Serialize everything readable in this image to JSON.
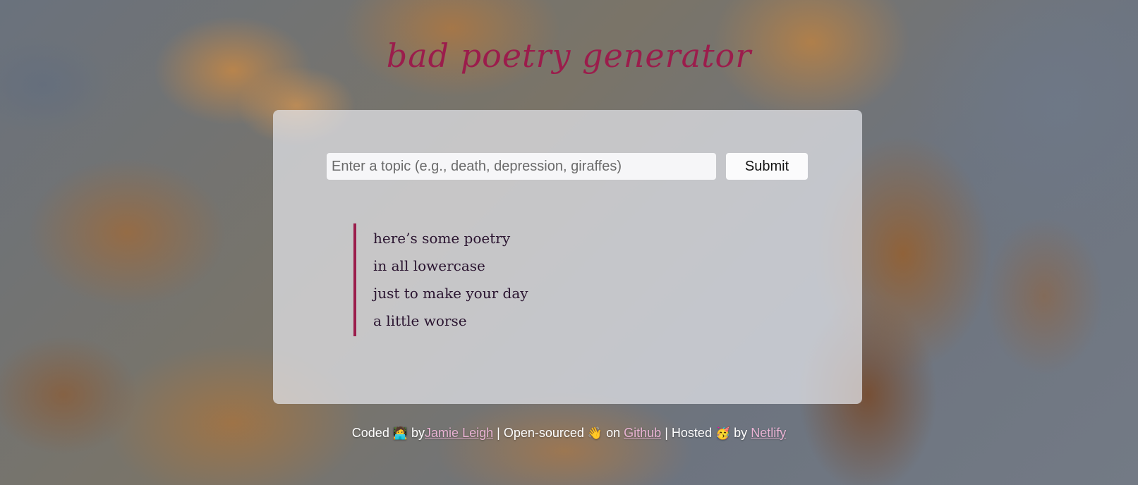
{
  "header": {
    "title": "bad poetry generator"
  },
  "form": {
    "topic_placeholder": "Enter a topic (e.g., death, depression, giraffes)",
    "topic_value": "",
    "submit_label": "Submit"
  },
  "poem": {
    "lines": [
      "here’s some poetry",
      "in all lowercase",
      "just to make your day",
      "a little worse"
    ]
  },
  "footer": {
    "coded_text": "Coded",
    "coded_emoji": "🧑‍💻",
    "by_text_1": "by",
    "author_link": "Jamie Leigh",
    "sep_1": "|",
    "open_sourced_text": "Open-sourced",
    "open_sourced_emoji": "👋",
    "on_text": "on",
    "github_link": "Github",
    "sep_2": "|",
    "hosted_text": "Hosted",
    "hosted_emoji": "🥳",
    "by_text_2": "by",
    "netlify_link": "Netlify"
  },
  "colors": {
    "accent": "#9b1d4c",
    "link": "#e9b3d4"
  }
}
